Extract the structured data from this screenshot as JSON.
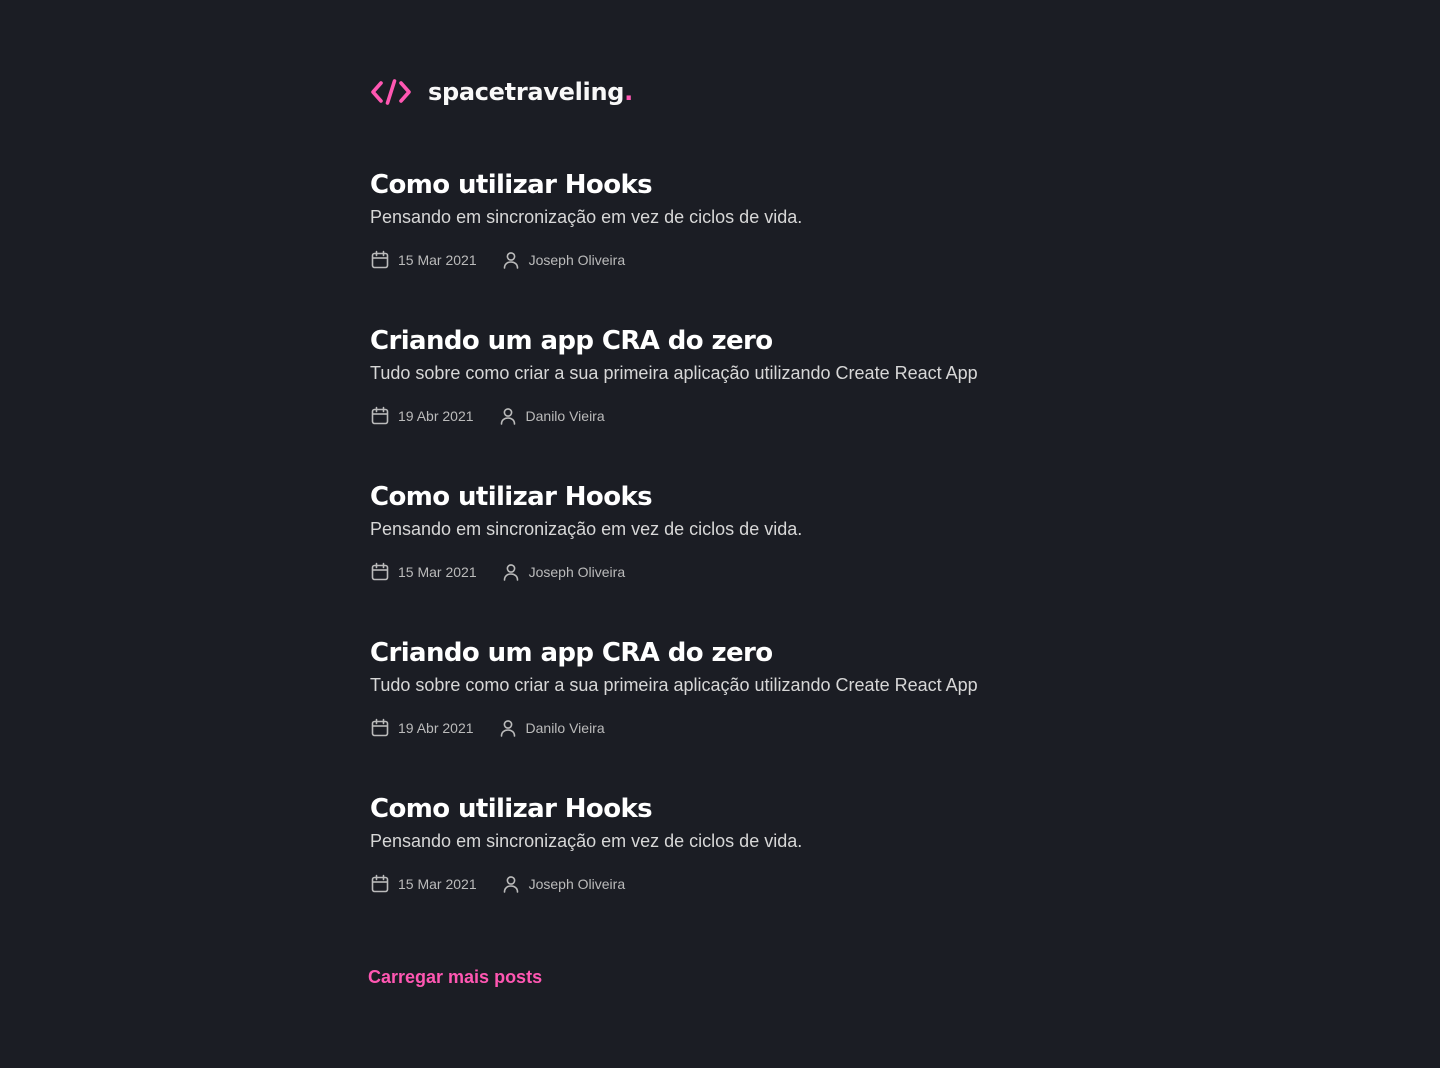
{
  "header": {
    "logo_name": "spacetraveling",
    "logo_dot": ".",
    "logo_icon": "code-brackets-icon",
    "accent_color": "#ff57b2"
  },
  "posts": [
    {
      "title": "Como utilizar Hooks",
      "subtitle": "Pensando em sincronização em vez de ciclos de vida.",
      "date": "15 Mar 2021",
      "author": "Joseph Oliveira"
    },
    {
      "title": "Criando um app CRA do zero",
      "subtitle": "Tudo sobre como criar a sua primeira aplicação utilizando Create React App",
      "date": "19 Abr 2021",
      "author": "Danilo Vieira"
    },
    {
      "title": "Como utilizar Hooks",
      "subtitle": "Pensando em sincronização em vez de ciclos de vida.",
      "date": "15 Mar 2021",
      "author": "Joseph Oliveira"
    },
    {
      "title": "Criando um app CRA do zero",
      "subtitle": "Tudo sobre como criar a sua primeira aplicação utilizando Create React App",
      "date": "19 Abr 2021",
      "author": "Danilo Vieira"
    },
    {
      "title": "Como utilizar Hooks",
      "subtitle": "Pensando em sincronização em vez de ciclos de vida.",
      "date": "15 Mar 2021",
      "author": "Joseph Oliveira"
    }
  ],
  "icons": {
    "date": "calendar-icon",
    "author": "user-icon"
  },
  "load_more_label": "Carregar mais posts"
}
